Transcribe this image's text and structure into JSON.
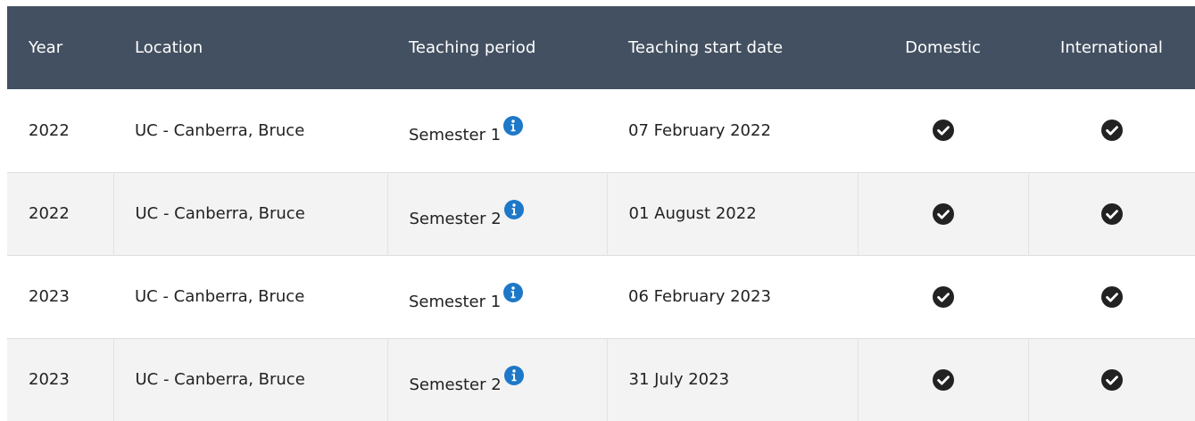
{
  "table": {
    "headers": {
      "year": "Year",
      "location": "Location",
      "period": "Teaching period",
      "start": "Teaching start date",
      "domestic": "Domestic",
      "international": "International"
    },
    "rows": [
      {
        "year": "2022",
        "location": "UC - Canberra, Bruce",
        "period": "Semester 1",
        "start": "07 February 2022",
        "domestic": "available",
        "international": "available"
      },
      {
        "year": "2022",
        "location": "UC - Canberra, Bruce",
        "period": "Semester 2",
        "start": "01 August 2022",
        "domestic": "available",
        "international": "available"
      },
      {
        "year": "2023",
        "location": "UC - Canberra, Bruce",
        "period": "Semester 1",
        "start": "06 February 2023",
        "domestic": "available",
        "international": "available"
      },
      {
        "year": "2023",
        "location": "UC - Canberra, Bruce",
        "period": "Semester 2",
        "start": "31 July 2023",
        "domestic": "available",
        "international": "available"
      }
    ]
  },
  "icons": {
    "info": "info-circle-icon",
    "check": "check-circle-icon"
  },
  "colors": {
    "header_bg": "#435061",
    "header_text": "#ffffff",
    "info_icon": "#1e78c8",
    "check_icon": "#222222",
    "alt_row_bg": "#f3f3f3"
  }
}
